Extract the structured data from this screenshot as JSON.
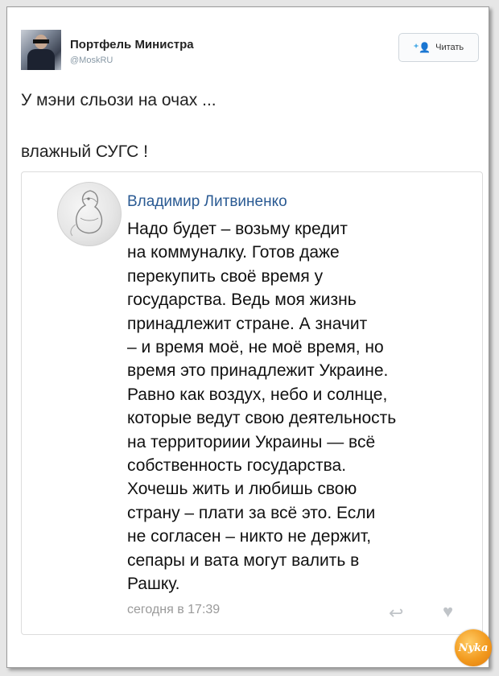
{
  "tweet": {
    "author_name": "Портфель Министра",
    "author_handle": "@MoskRU",
    "follow_label": "Читать",
    "text_lines": [
      "У мэни сльози на очах ...",
      "влажный СУГС !"
    ]
  },
  "quote": {
    "author_name": "Владимир Литвиненко",
    "text_lines": [
      "Надо будет – возьму кредит",
      "на коммуналку. Готов даже",
      "перекупить своё время у",
      "государства. Ведь моя жизнь",
      "принадлежит стране. А значит",
      "– и время моё, не моё время, но",
      "время это принадлежит Украине.",
      "Равно как воздух, небо и солнце,",
      "которые ведут свою деятельность",
      "на территориии Украины — всё",
      "собственность государства.",
      "Хочешь жить и любишь свою",
      "страну – плати за всё это. Если",
      "не согласен – никто не держит,",
      "сепары и вата могут валить в",
      "Рашку."
    ],
    "timestamp": "сегодня в 17:39"
  },
  "icons": {
    "follow": "add-user-icon",
    "reply": "reply-icon",
    "like": "heart-icon"
  },
  "colors": {
    "quote_author": "#2a5a93",
    "follow_icon": "#1b95e0",
    "watermark": "#f29a1e"
  },
  "watermark_text": "Nykа"
}
